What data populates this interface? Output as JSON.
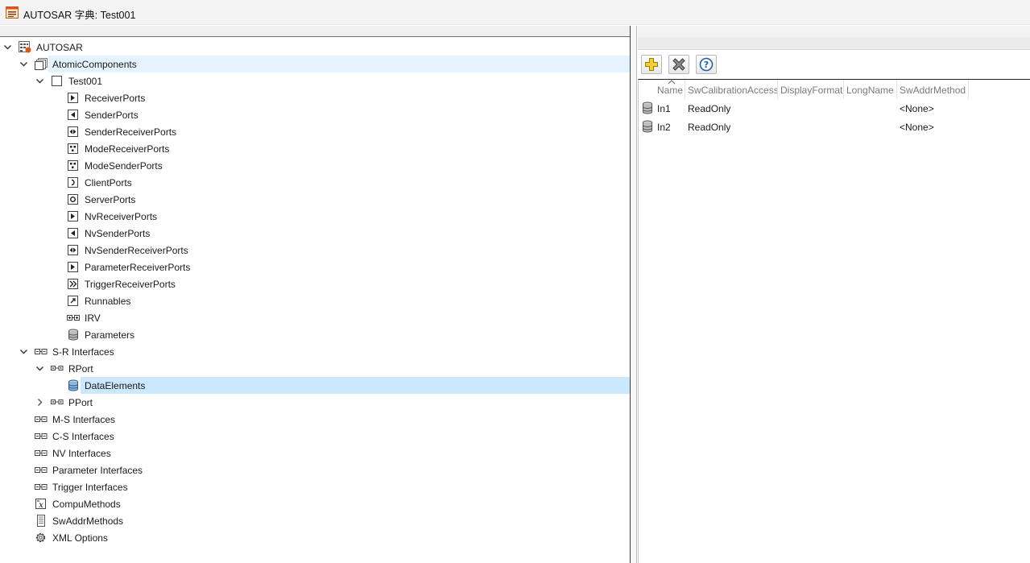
{
  "window": {
    "title": "AUTOSAR 字典: Test001"
  },
  "tree": {
    "nodes": [
      {
        "label": "AUTOSAR",
        "icon": "autosar-root-icon",
        "expanded": true
      },
      {
        "label": "AtomicComponents",
        "icon": "components-icon",
        "expanded": true,
        "state": "hover"
      },
      {
        "label": "Test001",
        "icon": "component-icon",
        "expanded": true
      },
      {
        "label": "ReceiverPorts",
        "icon": "receiver-port-icon"
      },
      {
        "label": "SenderPorts",
        "icon": "sender-port-icon"
      },
      {
        "label": "SenderReceiverPorts",
        "icon": "sender-receiver-port-icon"
      },
      {
        "label": "ModeReceiverPorts",
        "icon": "mode-receiver-port-icon"
      },
      {
        "label": "ModeSenderPorts",
        "icon": "mode-sender-port-icon"
      },
      {
        "label": "ClientPorts",
        "icon": "client-port-icon"
      },
      {
        "label": "ServerPorts",
        "icon": "server-port-icon"
      },
      {
        "label": "NvReceiverPorts",
        "icon": "nv-receiver-port-icon"
      },
      {
        "label": "NvSenderPorts",
        "icon": "nv-sender-port-icon"
      },
      {
        "label": "NvSenderReceiverPorts",
        "icon": "nv-sender-receiver-port-icon"
      },
      {
        "label": "ParameterReceiverPorts",
        "icon": "parameter-receiver-port-icon"
      },
      {
        "label": "TriggerReceiverPorts",
        "icon": "trigger-receiver-port-icon"
      },
      {
        "label": "Runnables",
        "icon": "runnables-icon"
      },
      {
        "label": "IRV",
        "icon": "irv-icon"
      },
      {
        "label": "Parameters",
        "icon": "parameters-database-icon"
      },
      {
        "label": "S-R Interfaces",
        "icon": "interfaces-icon",
        "expanded": true
      },
      {
        "label": "RPort",
        "icon": "interface-icon",
        "expanded": true
      },
      {
        "label": "DataElements",
        "icon": "data-elements-database-icon",
        "state": "selected"
      },
      {
        "label": "PPort",
        "icon": "interface-icon",
        "expanded": false
      },
      {
        "label": "M-S Interfaces",
        "icon": "interfaces-icon"
      },
      {
        "label": "C-S Interfaces",
        "icon": "interfaces-icon"
      },
      {
        "label": "NV Interfaces",
        "icon": "interfaces-icon"
      },
      {
        "label": "Parameter Interfaces",
        "icon": "interfaces-icon"
      },
      {
        "label": "Trigger Interfaces",
        "icon": "interfaces-icon"
      },
      {
        "label": "CompuMethods",
        "icon": "compu-methods-icon"
      },
      {
        "label": "SwAddrMethods",
        "icon": "sw-addr-methods-icon"
      },
      {
        "label": "XML Options",
        "icon": "gear-icon"
      }
    ]
  },
  "toolbar": {
    "add": {
      "icon": "add-plus-icon"
    },
    "delete": {
      "icon": "delete-x-icon"
    },
    "help": {
      "icon": "help-question-icon"
    }
  },
  "table": {
    "columns": [
      "Name",
      "SwCalibrationAccess",
      "DisplayFormat",
      "LongName",
      "SwAddrMethod"
    ],
    "rows": [
      {
        "name": "In1",
        "swCalibrationAccess": "ReadOnly",
        "displayFormat": "",
        "longName": "",
        "swAddrMethod": "<None>"
      },
      {
        "name": "In2",
        "swCalibrationAccess": "ReadOnly",
        "displayFormat": "",
        "longName": "",
        "swAddrMethod": "<None>"
      }
    ]
  },
  "colors": {
    "selected": "#cce8ff",
    "hover": "#e5f3ff",
    "add_icon": "#f2c21b",
    "help_icon": "#1f5fa8"
  }
}
